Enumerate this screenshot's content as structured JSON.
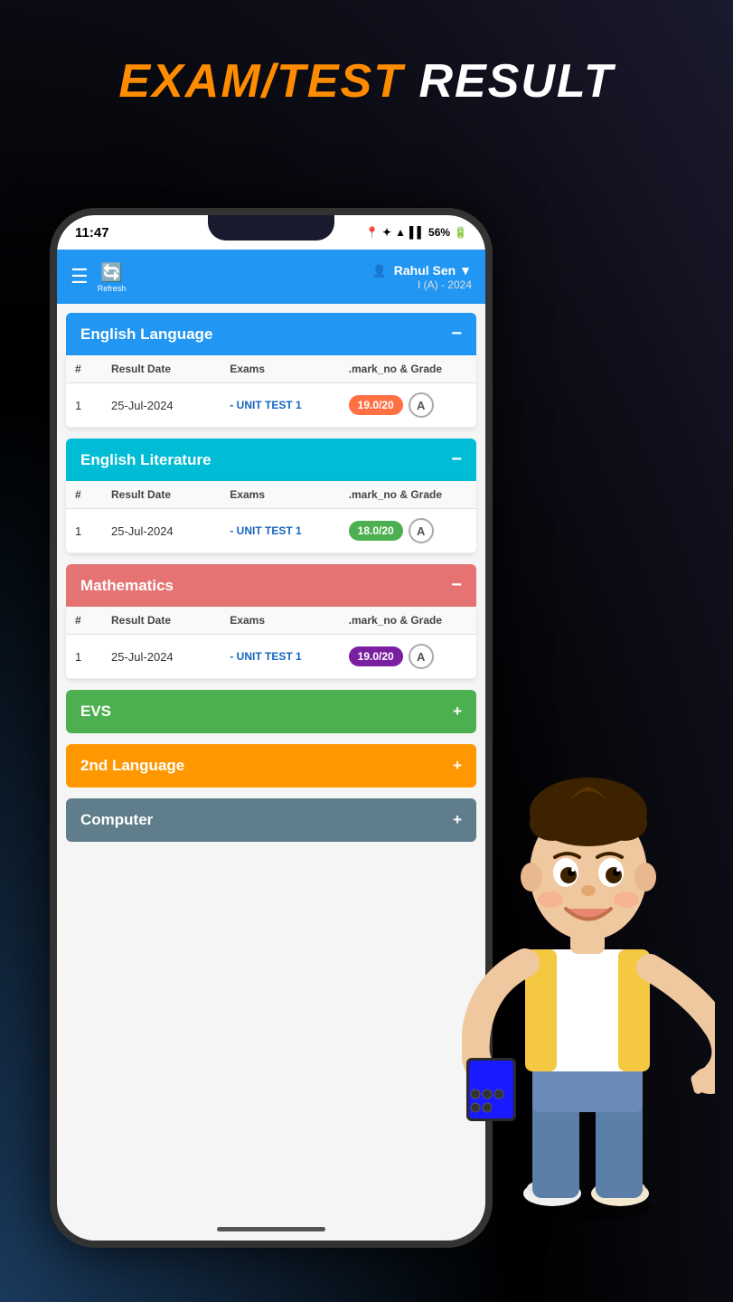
{
  "page": {
    "title_orange": "EXAM/TEST",
    "title_white": " RESULT"
  },
  "status_bar": {
    "time": "11:47",
    "battery": "56%"
  },
  "header": {
    "user_name": "Rahul Sen",
    "user_class": "I (A) - 2024",
    "refresh_label": "Refresh"
  },
  "subjects": [
    {
      "id": "english-language",
      "name": "English Language",
      "color": "blue",
      "collapsed": false,
      "toggle": "−",
      "columns": [
        "#",
        "Result Date",
        "Exams",
        ".mark_no & Grade"
      ],
      "rows": [
        {
          "num": "1",
          "date": "25-Jul-2024",
          "exam": "- UNIT TEST 1",
          "marks": "19.0/20",
          "grade": "A",
          "marks_color": "orange"
        }
      ]
    },
    {
      "id": "english-literature",
      "name": "English Literature",
      "color": "cyan",
      "collapsed": false,
      "toggle": "−",
      "columns": [
        "#",
        "Result Date",
        "Exams",
        ".mark_no & Grade"
      ],
      "rows": [
        {
          "num": "1",
          "date": "25-Jul-2024",
          "exam": "- UNIT TEST 1",
          "marks": "18.0/20",
          "grade": "A",
          "marks_color": "green"
        }
      ]
    },
    {
      "id": "mathematics",
      "name": "Mathematics",
      "color": "red",
      "collapsed": false,
      "toggle": "−",
      "columns": [
        "#",
        "Result Date",
        "Exams",
        ".mark_no & Grade"
      ],
      "rows": [
        {
          "num": "1",
          "date": "25-Jul-2024",
          "exam": "- UNIT TEST 1",
          "marks": "19.0/20",
          "grade": "A",
          "marks_color": "purple"
        }
      ]
    }
  ],
  "collapsed_subjects": [
    {
      "id": "evs",
      "name": "EVS",
      "color": "green",
      "toggle": "+"
    },
    {
      "id": "2nd-language",
      "name": "2nd Language",
      "color": "orange",
      "toggle": "+"
    },
    {
      "id": "computer",
      "name": "Computer",
      "color": "steel",
      "toggle": "+"
    }
  ]
}
